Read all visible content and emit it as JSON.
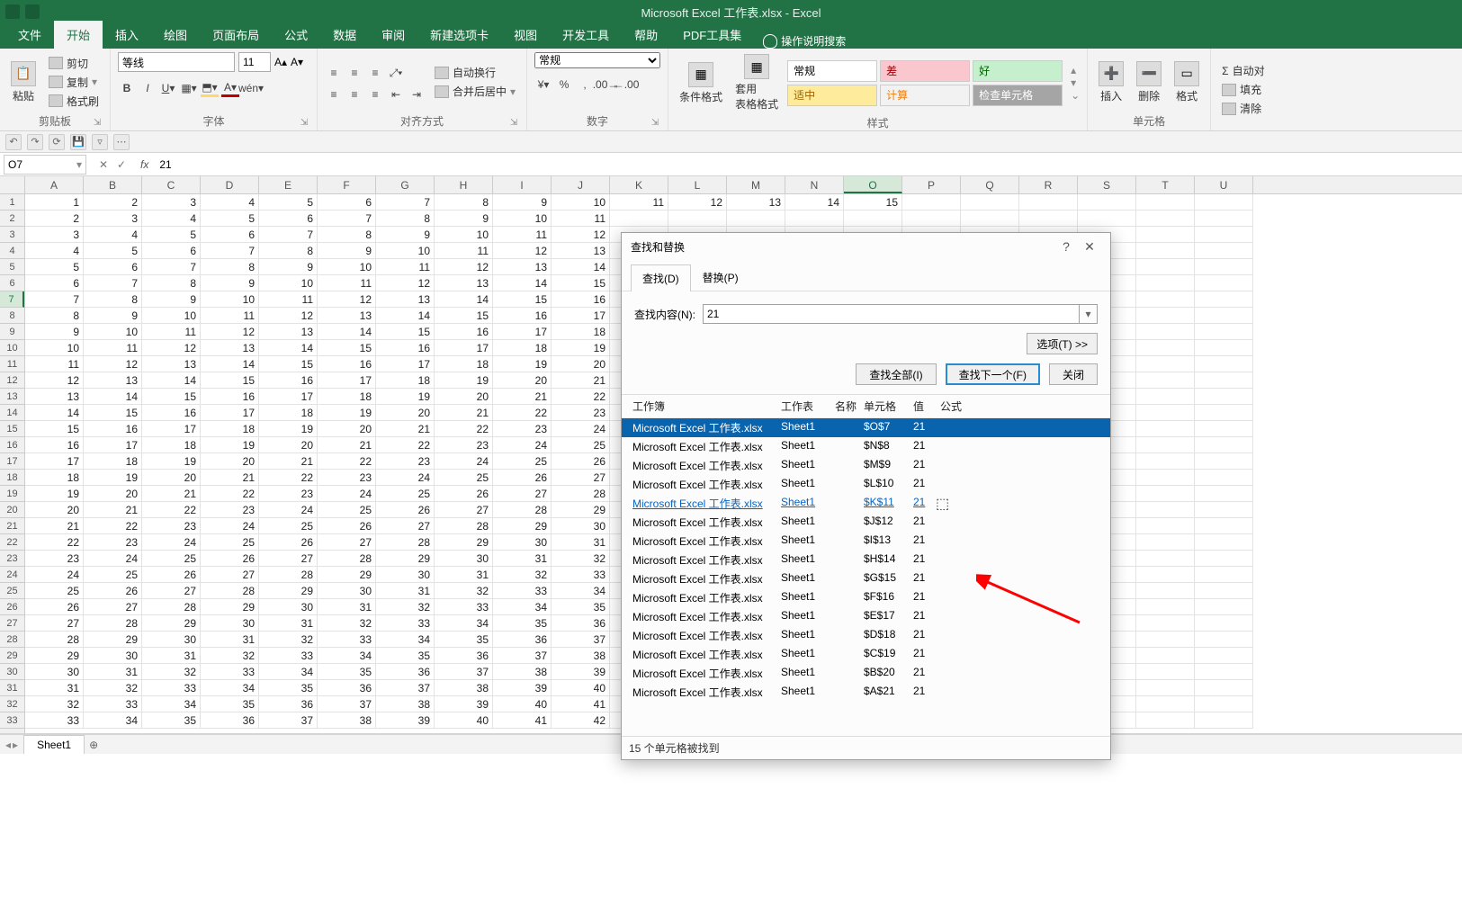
{
  "window": {
    "title": "Microsoft Excel 工作表.xlsx - Excel"
  },
  "ribbon_tabs": [
    "文件",
    "开始",
    "插入",
    "绘图",
    "页面布局",
    "公式",
    "数据",
    "审阅",
    "新建选项卡",
    "视图",
    "开发工具",
    "帮助",
    "PDF工具集"
  ],
  "ribbon_tabs_active_index": 1,
  "tell_me": "操作说明搜索",
  "ribbon": {
    "clipboard": {
      "label": "剪贴板",
      "paste": "粘贴",
      "cut": "剪切",
      "copy": "复制",
      "format_painter": "格式刷"
    },
    "font": {
      "label": "字体",
      "name": "等线",
      "size": "11"
    },
    "alignment": {
      "label": "对齐方式",
      "wrap": "自动换行",
      "merge": "合并后居中"
    },
    "number": {
      "label": "数字",
      "format": "常规"
    },
    "styles": {
      "label": "样式",
      "cond_format": "条件格式",
      "format_table": "套用\n表格格式",
      "cells": [
        {
          "text": "常规",
          "bg": "#ffffff",
          "fg": "#000"
        },
        {
          "text": "差",
          "bg": "#fac7ce",
          "fg": "#9c0006"
        },
        {
          "text": "好",
          "bg": "#c6efce",
          "fg": "#006100"
        },
        {
          "text": "适中",
          "bg": "#ffeb9c",
          "fg": "#9c6500"
        },
        {
          "text": "计算",
          "bg": "#f2f2f2",
          "fg": "#fa7d00"
        },
        {
          "text": "检查单元格",
          "bg": "#a5a5a5",
          "fg": "#fff"
        }
      ]
    },
    "cells_group": {
      "label": "单元格",
      "insert": "插入",
      "delete": "删除",
      "format": "格式"
    },
    "editing": {
      "autosum": "自动对",
      "fill": "填充",
      "clear": "清除"
    }
  },
  "namebox": "O7",
  "formula": "21",
  "columns": [
    "A",
    "B",
    "C",
    "D",
    "E",
    "F",
    "G",
    "H",
    "I",
    "J",
    "K",
    "L",
    "M",
    "N",
    "O",
    "P",
    "Q",
    "R",
    "S",
    "T",
    "U"
  ],
  "active_col_index": 14,
  "active_row": 7,
  "row_count": 33,
  "grid_rows": 33,
  "grid_cols": 10,
  "dialog": {
    "title": "查找和替换",
    "tab_find": "查找(D)",
    "tab_replace": "替换(P)",
    "active_tab": 0,
    "find_label": "查找内容(N):",
    "find_value": "21",
    "options_btn": "选项(T) >>",
    "find_all": "查找全部(I)",
    "find_next": "查找下一个(F)",
    "close": "关闭",
    "headers": {
      "book": "工作簿",
      "sheet": "工作表",
      "name": "名称",
      "cell": "单元格",
      "value": "值",
      "formula": "公式"
    },
    "results": [
      {
        "book": "Microsoft Excel 工作表.xlsx",
        "sheet": "Sheet1",
        "cell": "$O$7",
        "value": "21",
        "selected": true
      },
      {
        "book": "Microsoft Excel 工作表.xlsx",
        "sheet": "Sheet1",
        "cell": "$N$8",
        "value": "21"
      },
      {
        "book": "Microsoft Excel 工作表.xlsx",
        "sheet": "Sheet1",
        "cell": "$M$9",
        "value": "21"
      },
      {
        "book": "Microsoft Excel 工作表.xlsx",
        "sheet": "Sheet1",
        "cell": "$L$10",
        "value": "21"
      },
      {
        "book": "Microsoft Excel 工作表.xlsx",
        "sheet": "Sheet1",
        "cell": "$K$11",
        "value": "21",
        "link": true
      },
      {
        "book": "Microsoft Excel 工作表.xlsx",
        "sheet": "Sheet1",
        "cell": "$J$12",
        "value": "21"
      },
      {
        "book": "Microsoft Excel 工作表.xlsx",
        "sheet": "Sheet1",
        "cell": "$I$13",
        "value": "21"
      },
      {
        "book": "Microsoft Excel 工作表.xlsx",
        "sheet": "Sheet1",
        "cell": "$H$14",
        "value": "21"
      },
      {
        "book": "Microsoft Excel 工作表.xlsx",
        "sheet": "Sheet1",
        "cell": "$G$15",
        "value": "21"
      },
      {
        "book": "Microsoft Excel 工作表.xlsx",
        "sheet": "Sheet1",
        "cell": "$F$16",
        "value": "21"
      },
      {
        "book": "Microsoft Excel 工作表.xlsx",
        "sheet": "Sheet1",
        "cell": "$E$17",
        "value": "21"
      },
      {
        "book": "Microsoft Excel 工作表.xlsx",
        "sheet": "Sheet1",
        "cell": "$D$18",
        "value": "21"
      },
      {
        "book": "Microsoft Excel 工作表.xlsx",
        "sheet": "Sheet1",
        "cell": "$C$19",
        "value": "21"
      },
      {
        "book": "Microsoft Excel 工作表.xlsx",
        "sheet": "Sheet1",
        "cell": "$B$20",
        "value": "21"
      },
      {
        "book": "Microsoft Excel 工作表.xlsx",
        "sheet": "Sheet1",
        "cell": "$A$21",
        "value": "21"
      }
    ],
    "status": "15 个单元格被找到"
  },
  "sheet_tab": "Sheet1"
}
